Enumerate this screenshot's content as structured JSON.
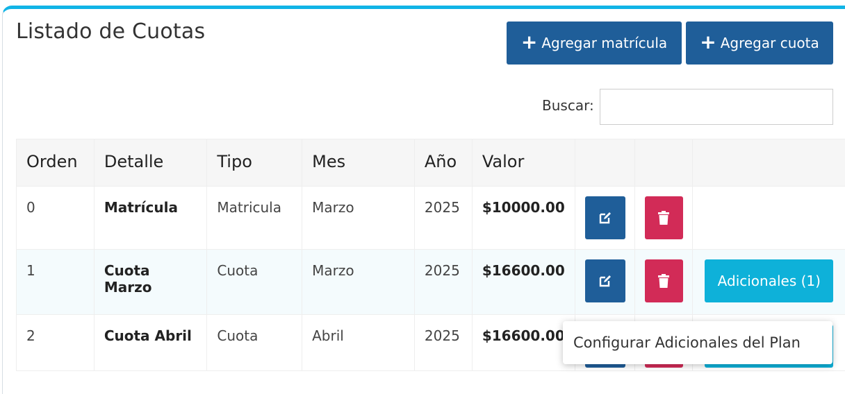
{
  "header": {
    "title": "Listado de Cuotas",
    "add_enrollment_label": "Agregar matrícula",
    "add_fee_label": "Agregar cuota",
    "plus_symbol": "+"
  },
  "search": {
    "label": "Buscar:",
    "value": ""
  },
  "table": {
    "columns": [
      "Orden",
      "Detalle",
      "Tipo",
      "Mes",
      "Año",
      "Valor"
    ],
    "rows": [
      {
        "orden": "0",
        "detalle": "Matrícula",
        "tipo": "Matricula",
        "mes": "Marzo",
        "anio": "2025",
        "valor": "$10000.00"
      },
      {
        "orden": "1",
        "detalle": "Cuota Marzo",
        "tipo": "Cuota",
        "mes": "Marzo",
        "anio": "2025",
        "valor": "$16600.00",
        "extra_label": "Adicionales (1)"
      },
      {
        "orden": "2",
        "detalle": "Cuota Abril",
        "tipo": "Cuota",
        "mes": "Abril",
        "anio": "2025",
        "valor": "$16600.00"
      }
    ]
  },
  "tooltip": {
    "text": "Configurar Adicionales del Plan"
  },
  "colors": {
    "accent_top_border": "#11b4e6",
    "primary_button": "#1f5e99",
    "delete_button": "#d22b57",
    "info_button": "#0eb1d9"
  },
  "icons": {
    "edit": "edit-icon",
    "delete": "trash-icon",
    "add": "plus-icon"
  }
}
